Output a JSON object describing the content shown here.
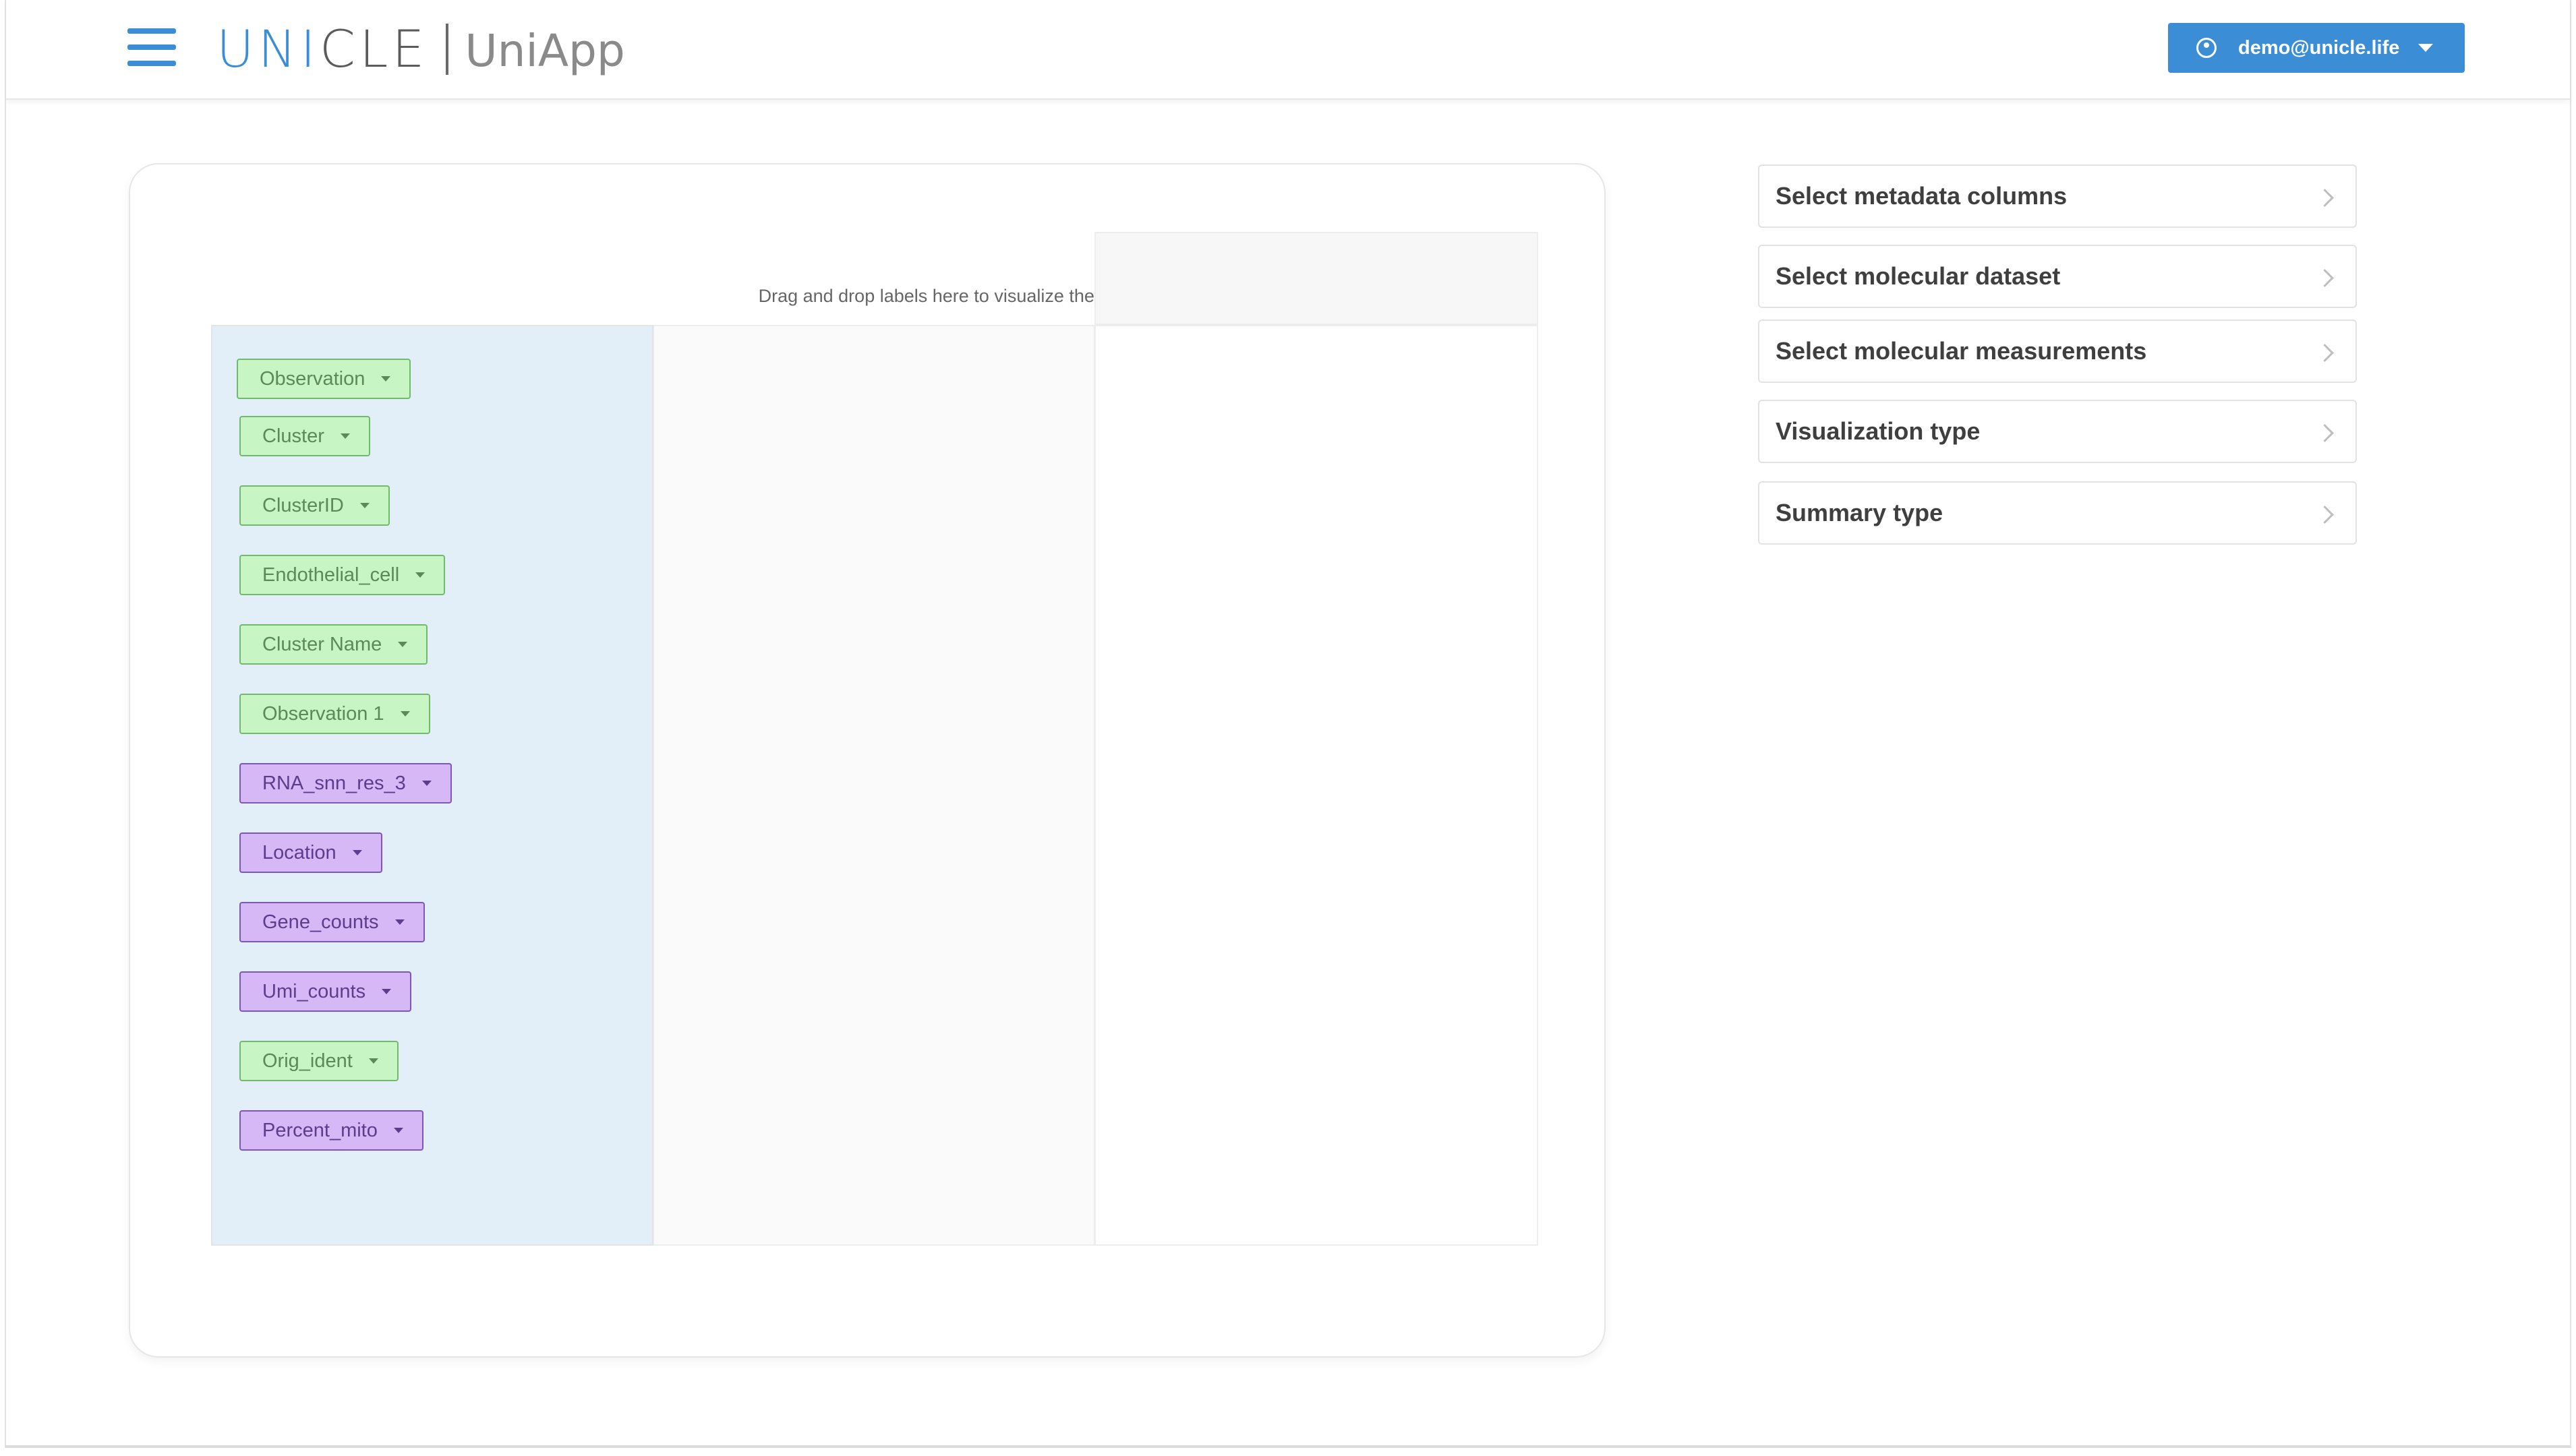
{
  "header": {
    "brand_part1": "UNI",
    "brand_part2": "CLE",
    "app_name": "UniApp",
    "user_email": "demo@unicle.life"
  },
  "workspace": {
    "drop_hint": "Drag and drop labels here to visualize them",
    "tags": [
      {
        "label": "Observation",
        "color": "green"
      },
      {
        "label": "Cluster",
        "color": "green"
      },
      {
        "label": "ClusterID",
        "color": "green"
      },
      {
        "label": "Endothelial_cell",
        "color": "green"
      },
      {
        "label": "Cluster Name",
        "color": "green"
      },
      {
        "label": "Observation 1",
        "color": "green"
      },
      {
        "label": "RNA_snn_res_3",
        "color": "purple"
      },
      {
        "label": "Location",
        "color": "purple"
      },
      {
        "label": "Gene_counts",
        "color": "purple"
      },
      {
        "label": "Umi_counts",
        "color": "purple"
      },
      {
        "label": "Orig_ident",
        "color": "green"
      },
      {
        "label": "Percent_mito",
        "color": "purple"
      }
    ]
  },
  "sidebar": {
    "items": [
      {
        "label": "Select metadata columns"
      },
      {
        "label": "Select molecular dataset"
      },
      {
        "label": "Select molecular measurements"
      },
      {
        "label": "Visualization type"
      },
      {
        "label": "Summary type"
      }
    ]
  },
  "colors": {
    "accent": "#3b8ed6",
    "tag_green_bg": "#c7f5c3",
    "tag_purple_bg": "#d6b8f7",
    "label_column_bg": "#e3eff8"
  }
}
